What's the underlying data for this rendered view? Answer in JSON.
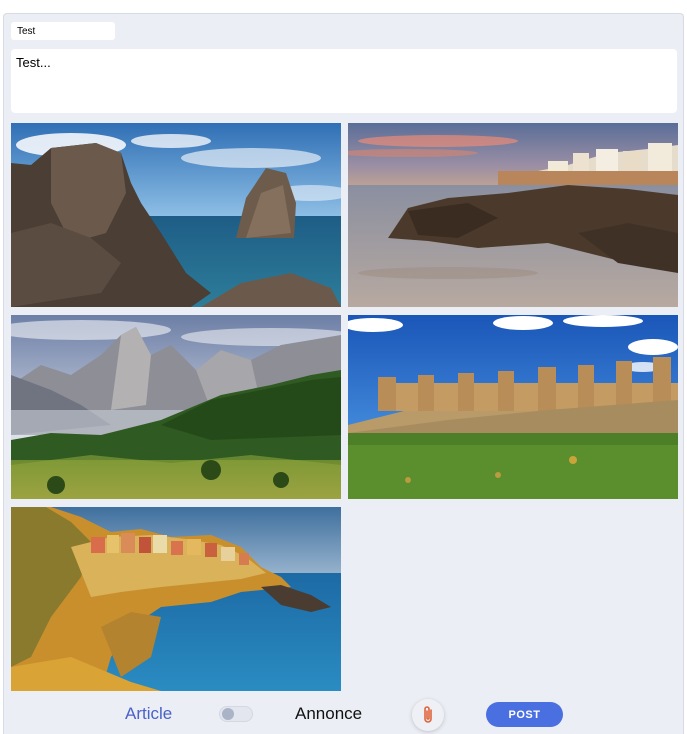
{
  "composer": {
    "title_value": "Test",
    "body_value": "Test..."
  },
  "photos": [
    {
      "icon": "rocky-coast-photo"
    },
    {
      "icon": "coastal-town-photo"
    },
    {
      "icon": "mountain-peaks-photo"
    },
    {
      "icon": "castle-field-photo"
    },
    {
      "icon": "cliff-village-photo"
    }
  ],
  "bottom_bar": {
    "article_label": "Article",
    "annonce_label": "Annonce",
    "post_label": "POST",
    "toggle_on": false,
    "attach_icon": "paperclip-icon"
  },
  "colors": {
    "accent": "#4a6fe0",
    "article_text": "#4a61c9",
    "attach_icon": "#e0643a",
    "panel_background": "#ebeef4"
  }
}
